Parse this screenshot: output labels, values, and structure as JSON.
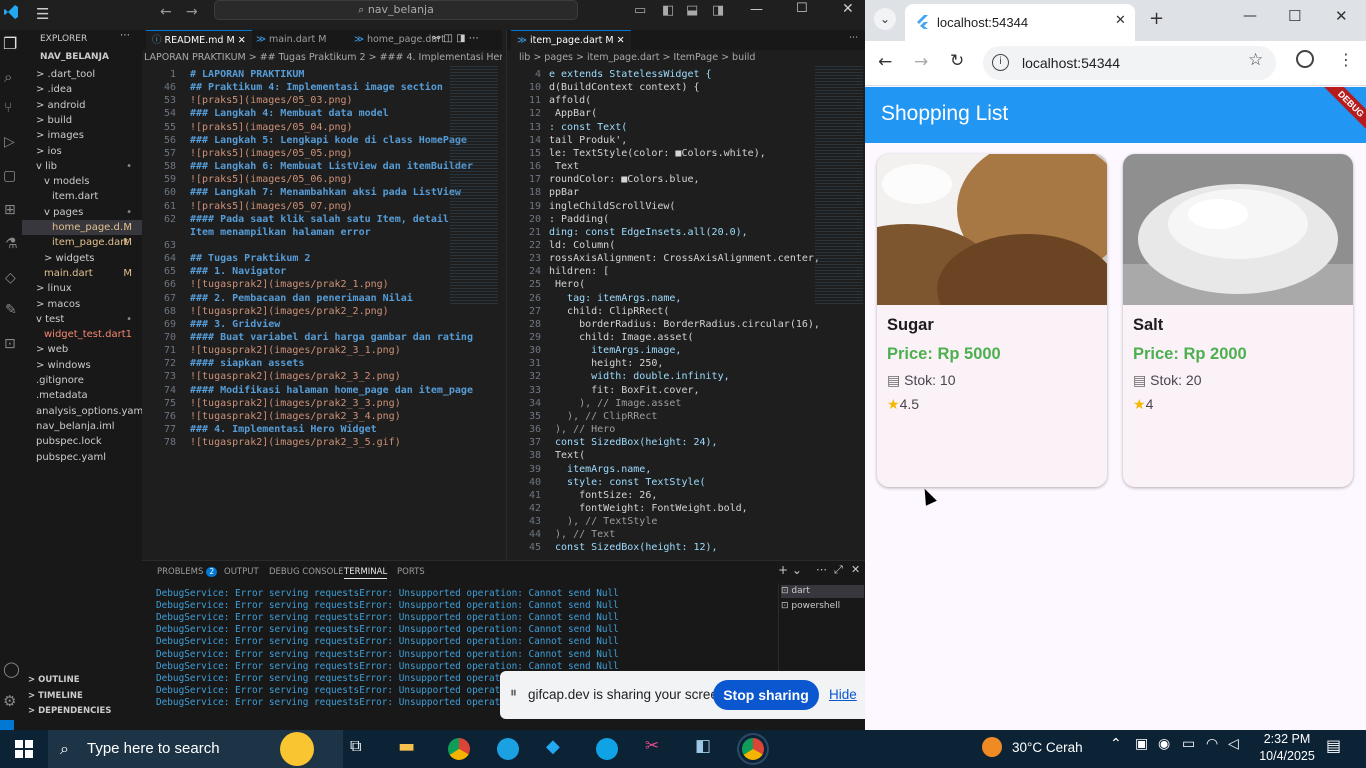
{
  "vscode": {
    "search_text": "nav_belanja",
    "explorer_title": "EXPLORER",
    "project_name": "NAV_BELANJA",
    "tree": [
      {
        "label": "> .dart_tool",
        "indent": 1,
        "badge": ""
      },
      {
        "label": "> .idea",
        "indent": 1,
        "badge": ""
      },
      {
        "label": "> android",
        "indent": 1,
        "badge": ""
      },
      {
        "label": "> build",
        "indent": 1,
        "badge": ""
      },
      {
        "label": "> images",
        "indent": 1,
        "badge": ""
      },
      {
        "label": "> ios",
        "indent": 1,
        "badge": ""
      },
      {
        "label": "v lib",
        "indent": 1,
        "badge": "•"
      },
      {
        "label": "v models",
        "indent": 2,
        "badge": ""
      },
      {
        "label": "item.dart",
        "indent": 3,
        "badge": ""
      },
      {
        "label": "v pages",
        "indent": 2,
        "badge": "•"
      },
      {
        "label": "home_page.d...",
        "indent": 3,
        "badge": "M"
      },
      {
        "label": "item_page.dart",
        "indent": 3,
        "badge": "M"
      },
      {
        "label": "> widgets",
        "indent": 2,
        "badge": ""
      },
      {
        "label": "main.dart",
        "indent": 2,
        "badge": "M"
      },
      {
        "label": "> linux",
        "indent": 1,
        "badge": ""
      },
      {
        "label": "> macos",
        "indent": 1,
        "badge": ""
      },
      {
        "label": "v test",
        "indent": 1,
        "badge": "•"
      },
      {
        "label": "widget_test.dart",
        "indent": 2,
        "badge": "1"
      },
      {
        "label": "> web",
        "indent": 1,
        "badge": ""
      },
      {
        "label": "> windows",
        "indent": 1,
        "badge": ""
      },
      {
        "label": ".gitignore",
        "indent": 1,
        "badge": ""
      },
      {
        "label": ".metadata",
        "indent": 1,
        "badge": ""
      },
      {
        "label": "analysis_options.yaml",
        "indent": 1,
        "badge": ""
      },
      {
        "label": "nav_belanja.iml",
        "indent": 1,
        "badge": ""
      },
      {
        "label": "pubspec.lock",
        "indent": 1,
        "badge": ""
      },
      {
        "label": "pubspec.yaml",
        "indent": 1,
        "badge": ""
      }
    ],
    "sections": [
      "OUTLINE",
      "TIMELINE",
      "DEPENDENCIES"
    ],
    "editor1_tabs": [
      "README.md M",
      "main.dart M",
      "home_page.dart"
    ],
    "editor1_crumb": "LAPORAN PRAKTIKUM > ## Tugas Praktikum 2 > ### 4. Implementasi Hero Widget",
    "editor1_lines": [
      {
        "n": "1",
        "t": "# LAPORAN PRAKTIKUM",
        "c": "md-h"
      },
      {
        "n": "46",
        "t": "## Praktikum 4: Implementasi image section",
        "c": "md-h"
      },
      {
        "n": "53",
        "t": "![praks5](images/05_03.png)",
        "c": "md-l"
      },
      {
        "n": "54",
        "t": "### Langkah 4: Membuat data model",
        "c": "md-h"
      },
      {
        "n": "55",
        "t": "![praks5](images/05_04.png)",
        "c": "md-l"
      },
      {
        "n": "56",
        "t": "### Langkah 5: Lengkapi kode di class HomePage",
        "c": "md-h"
      },
      {
        "n": "57",
        "t": "![praks5](images/05_05.png)",
        "c": "md-l"
      },
      {
        "n": "58",
        "t": "### Langkah 6: Membuat ListView dan itemBuilder",
        "c": "md-h"
      },
      {
        "n": "59",
        "t": "![praks5](images/05_06.png)",
        "c": "md-l"
      },
      {
        "n": "60",
        "t": "### Langkah 7: Menambahkan aksi pada ListView",
        "c": "md-h"
      },
      {
        "n": "61",
        "t": "![praks5](images/05_07.png)",
        "c": "md-l"
      },
      {
        "n": "62",
        "t": "#### Pada saat klik salah satu Item, detail",
        "c": "md-h"
      },
      {
        "n": "",
        "t": "Item menampilkan halaman error",
        "c": "md-h"
      },
      {
        "n": "63",
        "t": "",
        "c": ""
      },
      {
        "n": "64",
        "t": "## Tugas Praktikum 2",
        "c": "md-h"
      },
      {
        "n": "65",
        "t": "### 1. Navigator",
        "c": "md-h"
      },
      {
        "n": "66",
        "t": "![tugasprak2](images/prak2_1.png)",
        "c": "md-l"
      },
      {
        "n": "67",
        "t": "### 2. Pembacaan dan penerimaan Nilai",
        "c": "md-h"
      },
      {
        "n": "68",
        "t": "![tugasprak2](images/prak2_2.png)",
        "c": "md-l"
      },
      {
        "n": "69",
        "t": "### 3. Gridview",
        "c": "md-h"
      },
      {
        "n": "70",
        "t": "#### Buat variabel dari harga gambar dan rating",
        "c": "md-h"
      },
      {
        "n": "71",
        "t": "![tugasprak2](images/prak2_3_1.png)",
        "c": "md-l"
      },
      {
        "n": "72",
        "t": "#### siapkan assets",
        "c": "md-h"
      },
      {
        "n": "73",
        "t": "![tugasprak2](images/prak2_3_2.png)",
        "c": "md-l"
      },
      {
        "n": "74",
        "t": "#### Modifikasi halaman home_page dan item_page",
        "c": "md-h"
      },
      {
        "n": "75",
        "t": "![tugasprak2](images/prak2_3_3.png)",
        "c": "md-l"
      },
      {
        "n": "76",
        "t": "![tugasprak2](images/prak2_3_4.png)",
        "c": "md-l"
      },
      {
        "n": "77",
        "t": "### 4. Implementasi Hero Widget",
        "c": "md-h"
      },
      {
        "n": "78",
        "t": "![tugasprak2](images/prak2_3_5.gif)",
        "c": "md-l"
      }
    ],
    "editor2_tab": "item_page.dart M",
    "editor2_crumb": "lib > pages > item_page.dart > ItemPage > build",
    "editor2_lines": [
      {
        "n": "4",
        "t": "e extends StatelessWidget {"
      },
      {
        "n": "10",
        "t": "d(BuildContext context) {"
      },
      {
        "n": "11",
        "t": "affold("
      },
      {
        "n": "12",
        "t": " AppBar("
      },
      {
        "n": "13",
        "t": ": const Text("
      },
      {
        "n": "14",
        "t": "tail Produk',"
      },
      {
        "n": "15",
        "t": "le: TextStyle(color: ■Colors.white),"
      },
      {
        "n": "16",
        "t": " Text"
      },
      {
        "n": "17",
        "t": "roundColor: ■Colors.blue,"
      },
      {
        "n": "18",
        "t": "ppBar"
      },
      {
        "n": "19",
        "t": "ingleChildScrollView("
      },
      {
        "n": "20",
        "t": ": Padding("
      },
      {
        "n": "21",
        "t": "ding: const EdgeInsets.all(20.0),"
      },
      {
        "n": "22",
        "t": "ld: Column("
      },
      {
        "n": "23",
        "t": "rossAxisAlignment: CrossAxisAlignment.center,"
      },
      {
        "n": "24",
        "t": "hildren: ["
      },
      {
        "n": "25",
        "t": " Hero("
      },
      {
        "n": "26",
        "t": "   tag: itemArgs.name,"
      },
      {
        "n": "27",
        "t": "   child: ClipRRect("
      },
      {
        "n": "28",
        "t": "     borderRadius: BorderRadius.circular(16),"
      },
      {
        "n": "29",
        "t": "     child: Image.asset("
      },
      {
        "n": "30",
        "t": "       itemArgs.image,"
      },
      {
        "n": "31",
        "t": "       height: 250,"
      },
      {
        "n": "32",
        "t": "       width: double.infinity,"
      },
      {
        "n": "33",
        "t": "       fit: BoxFit.cover,"
      },
      {
        "n": "34",
        "t": "     ), // Image.asset"
      },
      {
        "n": "35",
        "t": "   ), // ClipRRect"
      },
      {
        "n": "36",
        "t": " ), // Hero"
      },
      {
        "n": "37",
        "t": " const SizedBox(height: 24),"
      },
      {
        "n": "38",
        "t": " Text("
      },
      {
        "n": "39",
        "t": "   itemArgs.name,"
      },
      {
        "n": "40",
        "t": "   style: const TextStyle("
      },
      {
        "n": "41",
        "t": "     fontSize: 26,"
      },
      {
        "n": "42",
        "t": "     fontWeight: FontWeight.bold,"
      },
      {
        "n": "43",
        "t": "   ), // TextStyle"
      },
      {
        "n": "44",
        "t": " ), // Text"
      },
      {
        "n": "45",
        "t": " const SizedBox(height: 12),"
      }
    ],
    "panel_tabs": [
      "PROBLEMS",
      "OUTPUT",
      "DEBUG CONSOLE",
      "TERMINAL",
      "PORTS"
    ],
    "problems_count": "2",
    "terminal_line": "DebugService: Error serving requestsError: Unsupported operation: Cannot send Null",
    "terminal_line_count": 10,
    "terminal_list": [
      "dart",
      "powershell"
    ],
    "share_text": "gifcap.dev is sharing your screen.",
    "stop_sharing": "Stop sharing",
    "hide": "Hide"
  },
  "browser": {
    "tab_title": "localhost:54344",
    "url": "localhost:54344",
    "app_title": "Shopping List",
    "debug_banner": "DEBUG",
    "appbar_color": "#2196f3",
    "items": [
      {
        "name": "Sugar",
        "price": "Price: Rp 5000",
        "stock": "Stok: 10",
        "rating": "4.5"
      },
      {
        "name": "Salt",
        "price": "Price: Rp 2000",
        "stock": "Stok: 20",
        "rating": "4"
      }
    ]
  },
  "taskbar": {
    "search_placeholder": "Type here to search",
    "weather": "30°C  Cerah",
    "time": "2:32 PM",
    "date": "10/4/2025"
  }
}
